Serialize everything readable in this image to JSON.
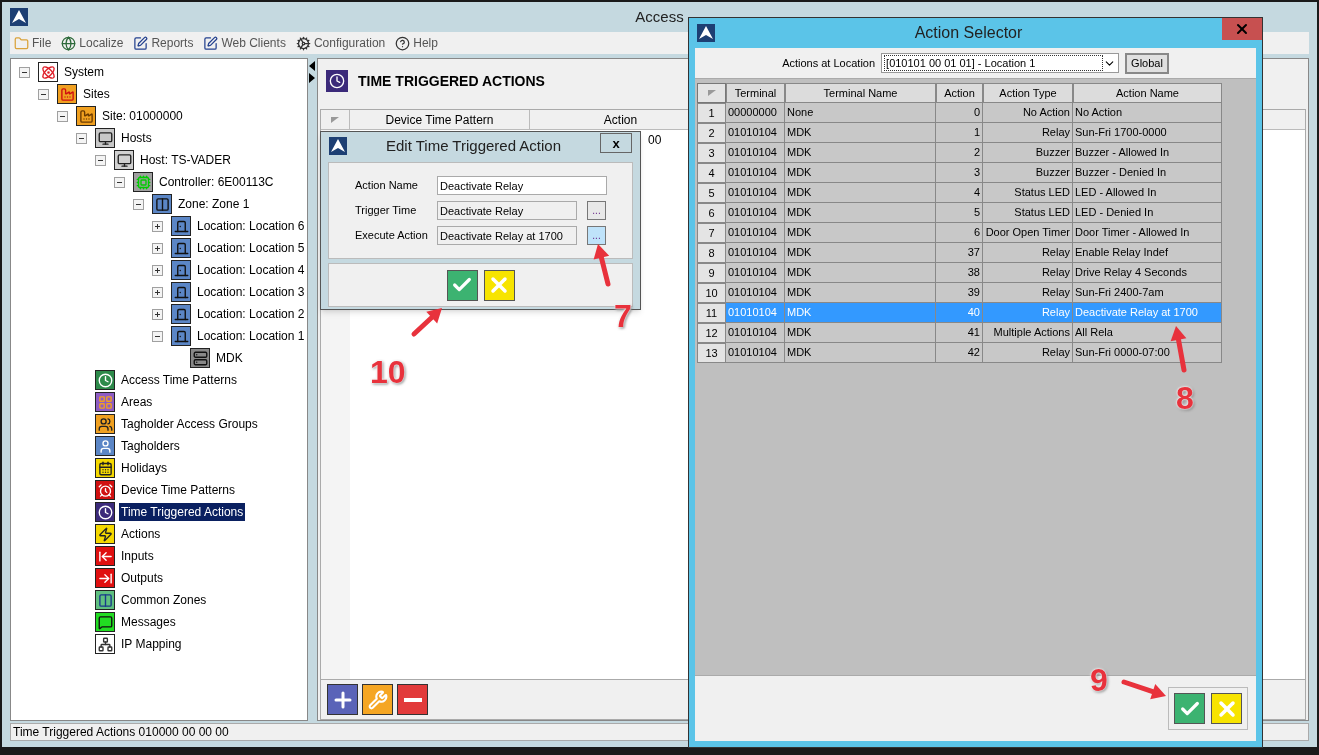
{
  "main_window": {
    "title": "Access",
    "menu": [
      {
        "label": "File",
        "kind": "folder"
      },
      {
        "label": "Localize",
        "kind": "globe"
      },
      {
        "label": "Reports",
        "kind": "report"
      },
      {
        "label": "Web Clients",
        "kind": "report"
      },
      {
        "label": "Configuration",
        "kind": "gears"
      },
      {
        "label": "Help",
        "kind": "help"
      }
    ],
    "tree": [
      {
        "label": "System",
        "kind": "system",
        "expanded": true,
        "selected": false,
        "children": [
          {
            "label": "Sites",
            "kind": "sites",
            "expanded": true,
            "selected": false,
            "children": [
              {
                "label": "Site: 01000000",
                "kind": "site",
                "expanded": true,
                "selected": false,
                "children": [
                  {
                    "label": "Hosts",
                    "kind": "hosts",
                    "expanded": true,
                    "selected": false,
                    "children": [
                      {
                        "label": "Host: TS-VADER",
                        "kind": "host",
                        "expanded": true,
                        "selected": false,
                        "children": [
                          {
                            "label": "Controller: 6E00113C",
                            "kind": "controller",
                            "expanded": true,
                            "selected": false,
                            "children": [
                              {
                                "label": "Zone: Zone 1",
                                "kind": "zone",
                                "expanded": true,
                                "selected": false,
                                "children": [
                                  {
                                    "label": "Location: Location 6",
                                    "kind": "location",
                                    "expanded": false,
                                    "selected": false
                                  },
                                  {
                                    "label": "Location: Location 5",
                                    "kind": "location",
                                    "expanded": false,
                                    "selected": false
                                  },
                                  {
                                    "label": "Location: Location 4",
                                    "kind": "location",
                                    "expanded": false,
                                    "selected": false
                                  },
                                  {
                                    "label": "Location: Location 3",
                                    "kind": "location",
                                    "expanded": false,
                                    "selected": false
                                  },
                                  {
                                    "label": "Location: Location 2",
                                    "kind": "location",
                                    "expanded": false,
                                    "selected": false
                                  },
                                  {
                                    "label": "Location: Location 1",
                                    "kind": "location",
                                    "expanded": true,
                                    "selected": false,
                                    "children": [
                                      {
                                        "label": "MDK",
                                        "kind": "terminal",
                                        "selected": false
                                      }
                                    ]
                                  }
                                ]
                              }
                            ]
                          }
                        ]
                      }
                    ]
                  },
                  {
                    "label": "Access Time Patterns",
                    "kind": "access-time",
                    "selected": false
                  },
                  {
                    "label": "Areas",
                    "kind": "areas",
                    "selected": false
                  },
                  {
                    "label": "Tagholder Access Groups",
                    "kind": "groups",
                    "selected": false
                  },
                  {
                    "label": "Tagholders",
                    "kind": "tagholders",
                    "selected": false
                  },
                  {
                    "label": "Holidays",
                    "kind": "holidays",
                    "selected": false
                  },
                  {
                    "label": "Device Time Patterns",
                    "kind": "device-time",
                    "selected": false
                  },
                  {
                    "label": "Time Triggered Actions",
                    "kind": "time-triggered",
                    "selected": true
                  },
                  {
                    "label": "Actions",
                    "kind": "actions",
                    "selected": false
                  },
                  {
                    "label": "Inputs",
                    "kind": "inputs",
                    "selected": false
                  },
                  {
                    "label": "Outputs",
                    "kind": "outputs",
                    "selected": false
                  },
                  {
                    "label": "Common Zones",
                    "kind": "common-zones",
                    "selected": false
                  },
                  {
                    "label": "Messages",
                    "kind": "messages",
                    "selected": false
                  },
                  {
                    "label": "IP Mapping",
                    "kind": "ip-mapping",
                    "selected": false
                  }
                ]
              }
            ]
          }
        ]
      }
    ],
    "content": {
      "heading": "TIME TRIGGERED ACTIONS",
      "columns": [
        "Device Time Pattern",
        "Action"
      ],
      "rows": [
        {
          "action": "00"
        }
      ]
    },
    "status_bar": "Time Triggered Actions 010000 00 00 00"
  },
  "edit_dialog": {
    "title": "Edit Time Triggered Action",
    "close": "x",
    "fields": [
      {
        "label": "Action Name",
        "value": "Deactivate Relay",
        "kind": "text"
      },
      {
        "label": "Trigger Time",
        "value": "Deactivate Relay",
        "kind": "browse",
        "button": "...",
        "highlighted": false
      },
      {
        "label": "Execute Action",
        "value": "Deactivate Relay at 1700",
        "kind": "browse",
        "button": "...",
        "highlighted": true
      }
    ]
  },
  "action_selector": {
    "title": "Action Selector",
    "location_label": "Actions at Location",
    "location_value": "[010101 00 01 01] - Location 1",
    "global_button": "Global",
    "columns": [
      "Terminal",
      "Terminal Name",
      "Action",
      "Action Type",
      "Action Name"
    ],
    "rows": [
      {
        "index": "1",
        "terminal": "00000000",
        "terminal_name": "None",
        "action": "0",
        "action_type": "No Action",
        "action_name": "No Action",
        "selected": false
      },
      {
        "index": "2",
        "terminal": "01010104",
        "terminal_name": "MDK",
        "action": "1",
        "action_type": "Relay",
        "action_name": "Sun-Fri 1700-0000",
        "selected": false
      },
      {
        "index": "3",
        "terminal": "01010104",
        "terminal_name": "MDK",
        "action": "2",
        "action_type": "Buzzer",
        "action_name": "Buzzer - Allowed In",
        "selected": false
      },
      {
        "index": "4",
        "terminal": "01010104",
        "terminal_name": "MDK",
        "action": "3",
        "action_type": "Buzzer",
        "action_name": "Buzzer - Denied In",
        "selected": false
      },
      {
        "index": "5",
        "terminal": "01010104",
        "terminal_name": "MDK",
        "action": "4",
        "action_type": "Status LED",
        "action_name": "LED - Allowed In",
        "selected": false
      },
      {
        "index": "6",
        "terminal": "01010104",
        "terminal_name": "MDK",
        "action": "5",
        "action_type": "Status LED",
        "action_name": "LED - Denied In",
        "selected": false
      },
      {
        "index": "7",
        "terminal": "01010104",
        "terminal_name": "MDK",
        "action": "6",
        "action_type": "Door Open Timer",
        "action_name": "Door Timer - Allowed In",
        "selected": false
      },
      {
        "index": "8",
        "terminal": "01010104",
        "terminal_name": "MDK",
        "action": "37",
        "action_type": "Relay",
        "action_name": "Enable Relay Indef",
        "selected": false
      },
      {
        "index": "9",
        "terminal": "01010104",
        "terminal_name": "MDK",
        "action": "38",
        "action_type": "Relay",
        "action_name": "Drive Relay 4 Seconds",
        "selected": false
      },
      {
        "index": "10",
        "terminal": "01010104",
        "terminal_name": "MDK",
        "action": "39",
        "action_type": "Relay",
        "action_name": "Sun-Fri 2400-7am",
        "selected": false
      },
      {
        "index": "11",
        "terminal": "01010104",
        "terminal_name": "MDK",
        "action": "40",
        "action_type": "Relay",
        "action_name": "Deactivate Relay at 1700",
        "selected": true
      },
      {
        "index": "12",
        "terminal": "01010104",
        "terminal_name": "MDK",
        "action": "41",
        "action_type": "Multiple Actions",
        "action_name": "All Rela",
        "selected": false
      },
      {
        "index": "13",
        "terminal": "01010104",
        "terminal_name": "MDK",
        "action": "42",
        "action_type": "Relay",
        "action_name": "Sun-Fri 0000-07:00",
        "selected": false
      }
    ]
  },
  "annotations": [
    {
      "label": "7"
    },
    {
      "label": "8"
    },
    {
      "label": "9"
    },
    {
      "label": "10"
    }
  ]
}
